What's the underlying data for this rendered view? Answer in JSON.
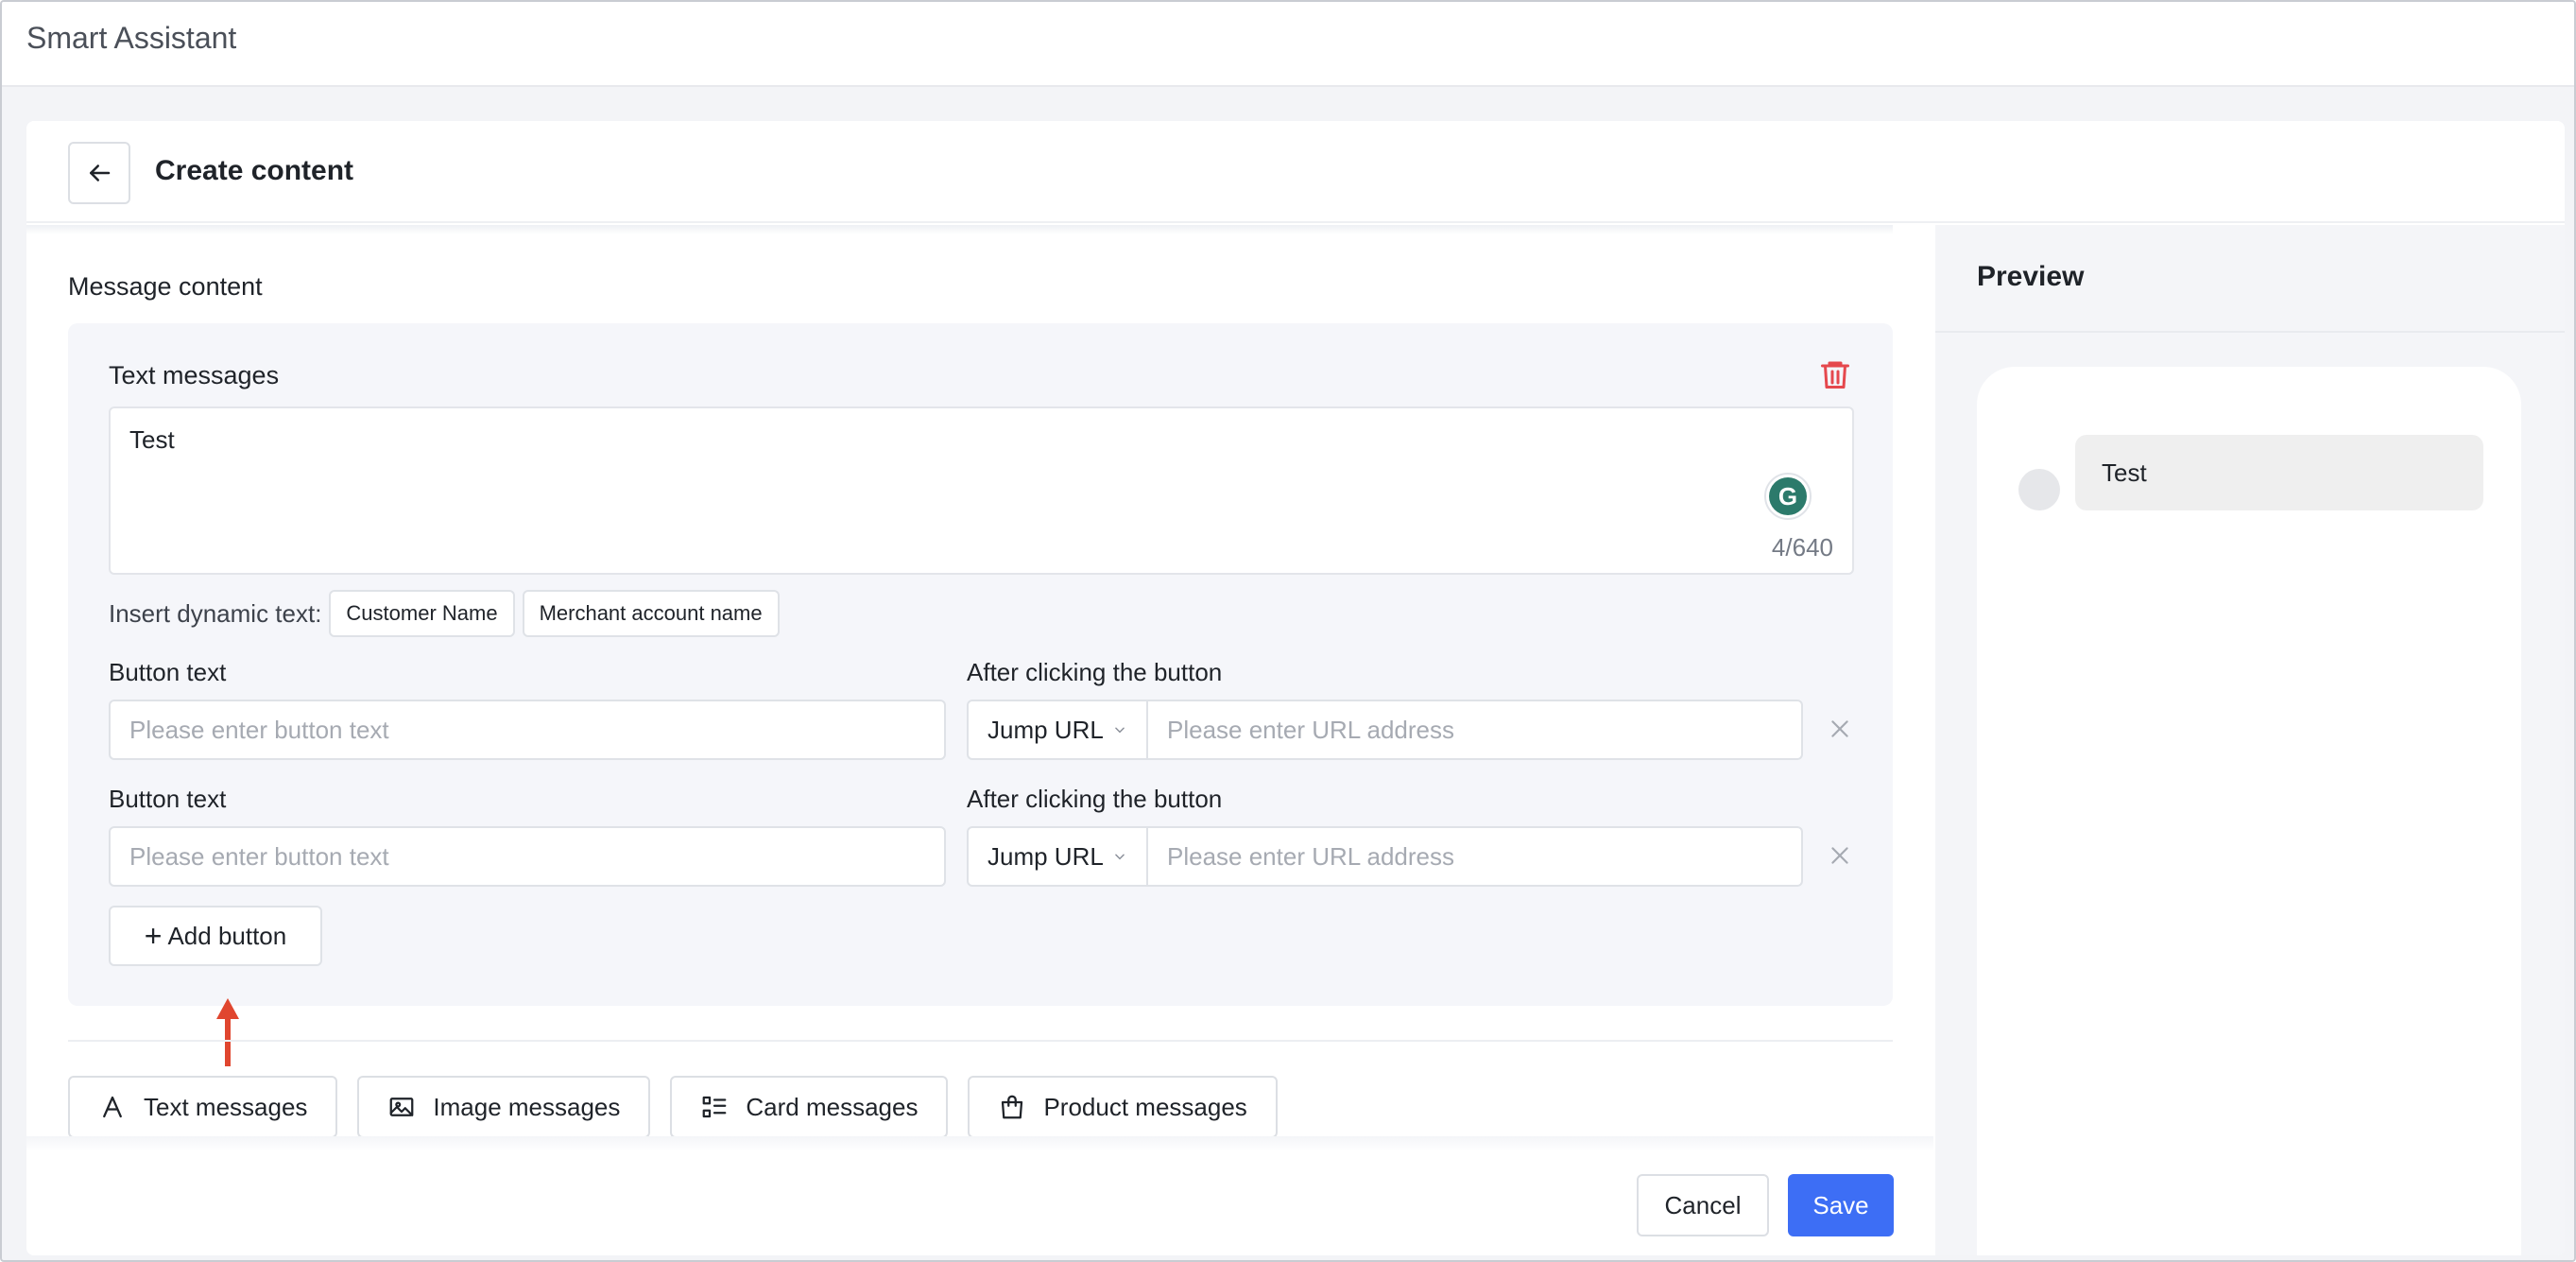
{
  "app": {
    "title": "Smart Assistant"
  },
  "header": {
    "title": "Create content"
  },
  "section": {
    "label": "Message content"
  },
  "text_card": {
    "title": "Text messages",
    "value": "Test",
    "counter": "4/640",
    "insert_label": "Insert dynamic text:",
    "chips": [
      "Customer Name",
      "Merchant account name"
    ],
    "rows": [
      {
        "button_label": "Button text",
        "button_placeholder": "Please enter button text",
        "action_label": "After clicking the button",
        "action_value": "Jump URL",
        "url_placeholder": "Please enter URL address"
      },
      {
        "button_label": "Button text",
        "button_placeholder": "Please enter button text",
        "action_label": "After clicking the button",
        "action_value": "Jump URL",
        "url_placeholder": "Please enter URL address"
      }
    ],
    "add_button": "Add button"
  },
  "message_types": [
    {
      "label": "Text messages",
      "icon": "letter-a-icon"
    },
    {
      "label": "Image messages",
      "icon": "image-icon"
    },
    {
      "label": "Card messages",
      "icon": "list-icon"
    },
    {
      "label": "Product messages",
      "icon": "shopping-bag-icon"
    }
  ],
  "footer": {
    "cancel": "Cancel",
    "save": "Save"
  },
  "preview": {
    "title": "Preview",
    "bubble_text": "Test"
  },
  "colors": {
    "primary": "#3d6ef5",
    "danger": "#e5484d",
    "annotation": "#e0462f",
    "grammarly": "#2c7a6b"
  }
}
